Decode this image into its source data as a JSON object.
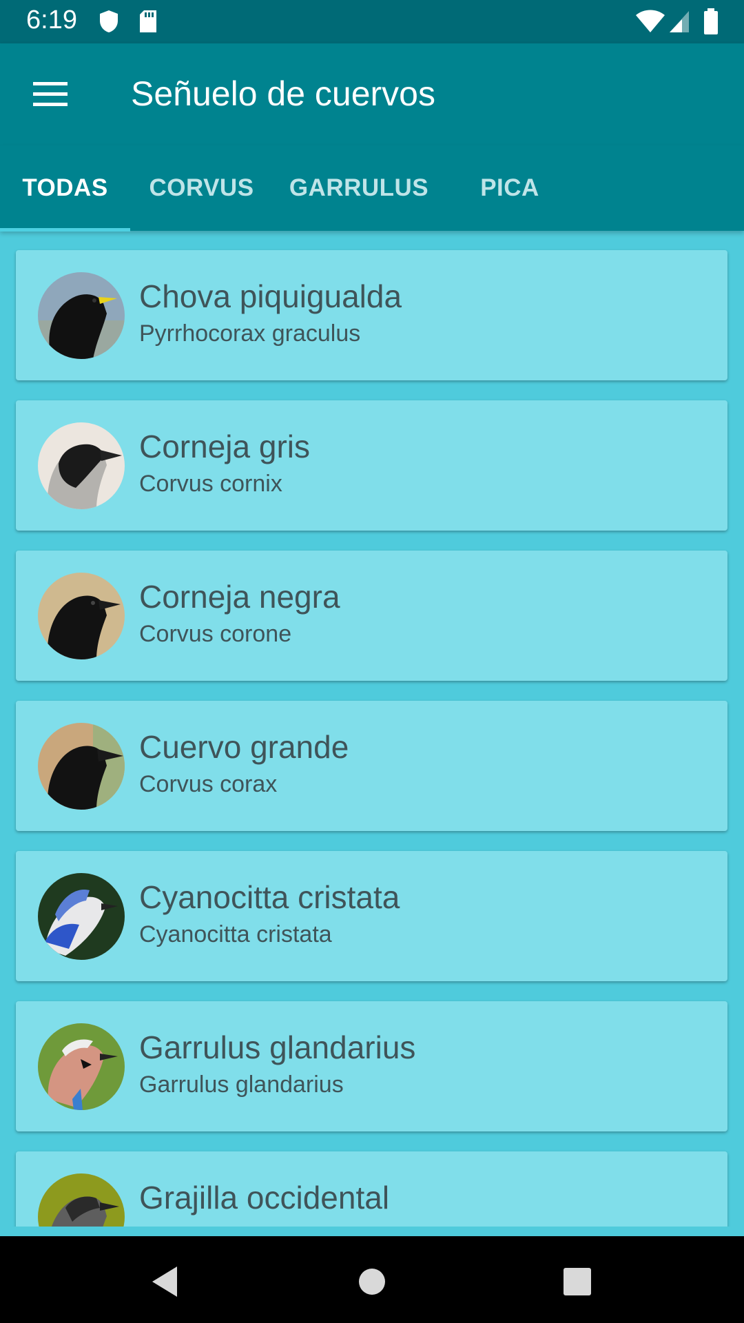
{
  "status": {
    "time": "6:19"
  },
  "appbar": {
    "title": "Señuelo de cuervos",
    "menu_icon": "menu-icon"
  },
  "tabs": [
    {
      "label": "TODAS",
      "active": true
    },
    {
      "label": "CORVUS",
      "active": false
    },
    {
      "label": "GARRULUS",
      "active": false
    },
    {
      "label": "PICA",
      "active": false
    }
  ],
  "birds": [
    {
      "name": "Chova piquigualda",
      "scientific": "Pyrrhocorax graculus"
    },
    {
      "name": "Corneja gris",
      "scientific": "Corvus cornix"
    },
    {
      "name": "Corneja negra",
      "scientific": "Corvus corone"
    },
    {
      "name": "Cuervo grande",
      "scientific": "Corvus corax"
    },
    {
      "name": "Cyanocitta cristata",
      "scientific": "Cyanocitta cristata"
    },
    {
      "name": "Garrulus glandarius",
      "scientific": "Garrulus glandarius"
    },
    {
      "name": "Grajilla occidental",
      "scientific": ""
    }
  ],
  "colors": {
    "statusbar": "#006a76",
    "appbar": "#00838f",
    "background": "#4fcbdc",
    "card": "#80deea",
    "indicator": "#4dd0e1",
    "text": "#3f5459"
  }
}
